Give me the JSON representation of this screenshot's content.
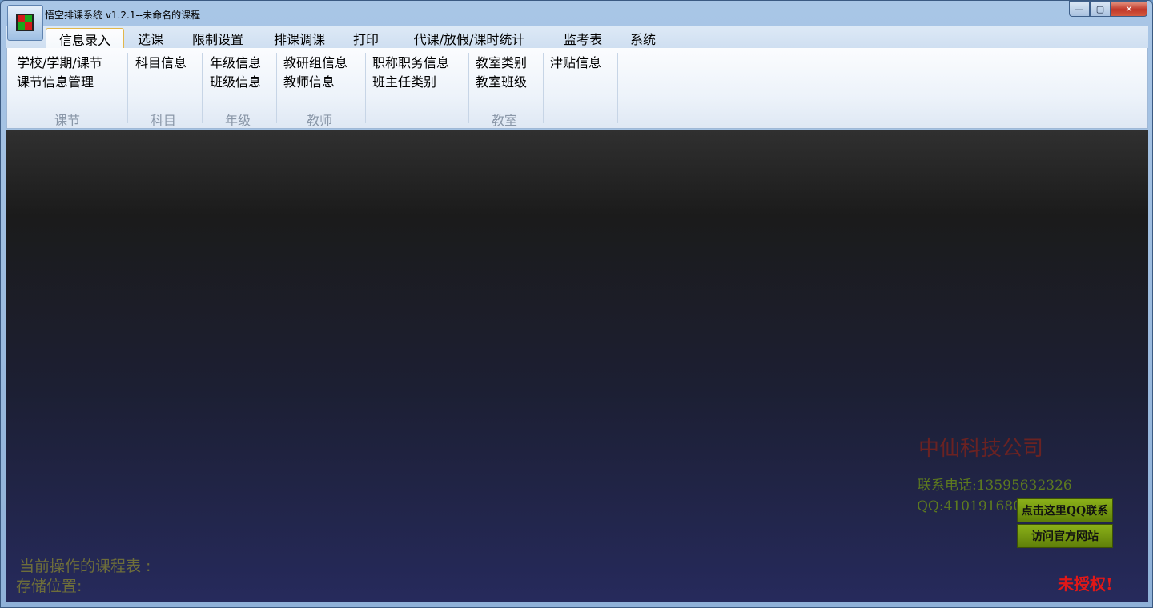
{
  "window": {
    "title": "悟空排课系统 v1.2.1--未命名的课程",
    "controls": {
      "minimize": "—",
      "maximize": "▢",
      "close": "✕"
    }
  },
  "tabs": [
    {
      "label": "信息录入",
      "active": true
    },
    {
      "label": "选课"
    },
    {
      "label": "限制设置"
    },
    {
      "label": "排课调课"
    },
    {
      "label": "打印"
    },
    {
      "label": "代课/放假/课时统计"
    },
    {
      "label": "监考表"
    },
    {
      "label": "系统"
    }
  ],
  "ribbon": {
    "groups": [
      {
        "label": "课节",
        "items": [
          "学校/学期/课节",
          "课节信息管理"
        ]
      },
      {
        "label": "科目",
        "items": [
          "科目信息"
        ]
      },
      {
        "label": "年级",
        "items": [
          "年级信息",
          "班级信息"
        ]
      },
      {
        "label": "教师",
        "items": [
          "教研组信息",
          "教师信息"
        ]
      },
      {
        "label": "",
        "items": [
          "职称职务信息",
          "班主任类别"
        ]
      },
      {
        "label": "教室",
        "items": [
          "教室类别",
          "教室班级"
        ]
      },
      {
        "label": "",
        "items": [
          "津贴信息"
        ]
      }
    ]
  },
  "main": {
    "company": "中仙科技公司",
    "phone": "联系电话:13595632326",
    "qq": "QQ:410191680",
    "qq_button": "点击这里QQ联系",
    "site_button": "访问官方网站",
    "unauthorized": "未授权!",
    "current_table_label": "当前操作的课程表 :",
    "storage_label": "存储位置:"
  },
  "colors": {
    "company": "#6b2222",
    "contact": "#5d7a1f",
    "unauthorized": "#e01818",
    "button_green": "#7a9f12",
    "status_text": "#6e6e3a",
    "active_tab_border": "#e2b74b"
  }
}
